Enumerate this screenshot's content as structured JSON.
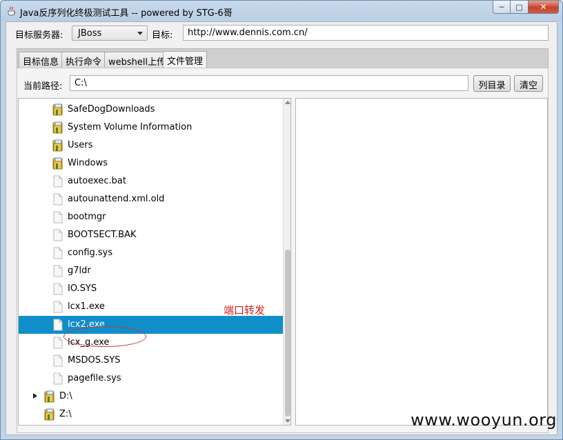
{
  "window": {
    "title": "Java反序列化终极测试工具  -- powered by STG-6哥",
    "controls": [
      "minimize",
      "maximize",
      "close"
    ]
  },
  "toolbar": {
    "server_label": "目标服务器:",
    "server_value": "JBoss",
    "target_label": "目标:",
    "target_value": "http://www.dennis.com.cn/"
  },
  "tabs": [
    {
      "label": "目标信息",
      "active": false
    },
    {
      "label": "执行命令",
      "active": false
    },
    {
      "label": "webshell上传",
      "active": false
    },
    {
      "label": "文件管理",
      "active": true
    }
  ],
  "file_manager": {
    "path_label": "当前路径:",
    "path_value": "C:\\",
    "list_button": "列目录",
    "clear_button": "清空",
    "tree": [
      {
        "name": "SafeDogDownloads",
        "type": "folder"
      },
      {
        "name": "System Volume Information",
        "type": "folder"
      },
      {
        "name": "Users",
        "type": "folder"
      },
      {
        "name": "Windows",
        "type": "folder"
      },
      {
        "name": "autoexec.bat",
        "type": "file"
      },
      {
        "name": "autounattend.xml.old",
        "type": "file"
      },
      {
        "name": "bootmgr",
        "type": "file"
      },
      {
        "name": "BOOTSECT.BAK",
        "type": "file"
      },
      {
        "name": "config.sys",
        "type": "file"
      },
      {
        "name": "g7ldr",
        "type": "file"
      },
      {
        "name": "IO.SYS",
        "type": "file"
      },
      {
        "name": "lcx1.exe",
        "type": "file"
      },
      {
        "name": "lcx2.exe",
        "type": "file",
        "selected": true
      },
      {
        "name": "lcx_g.exe",
        "type": "file"
      },
      {
        "name": "MSDOS.SYS",
        "type": "file"
      },
      {
        "name": "pagefile.sys",
        "type": "file"
      },
      {
        "name": "D:\\",
        "type": "drive",
        "expandable": true
      },
      {
        "name": "Z:\\",
        "type": "drive"
      }
    ]
  },
  "annotation": {
    "text": "端口转发",
    "color": "#d0201c"
  },
  "watermark": "www.wooyun.org",
  "colors": {
    "selection": "#0f8ec9",
    "close_button": "#c7442c"
  }
}
